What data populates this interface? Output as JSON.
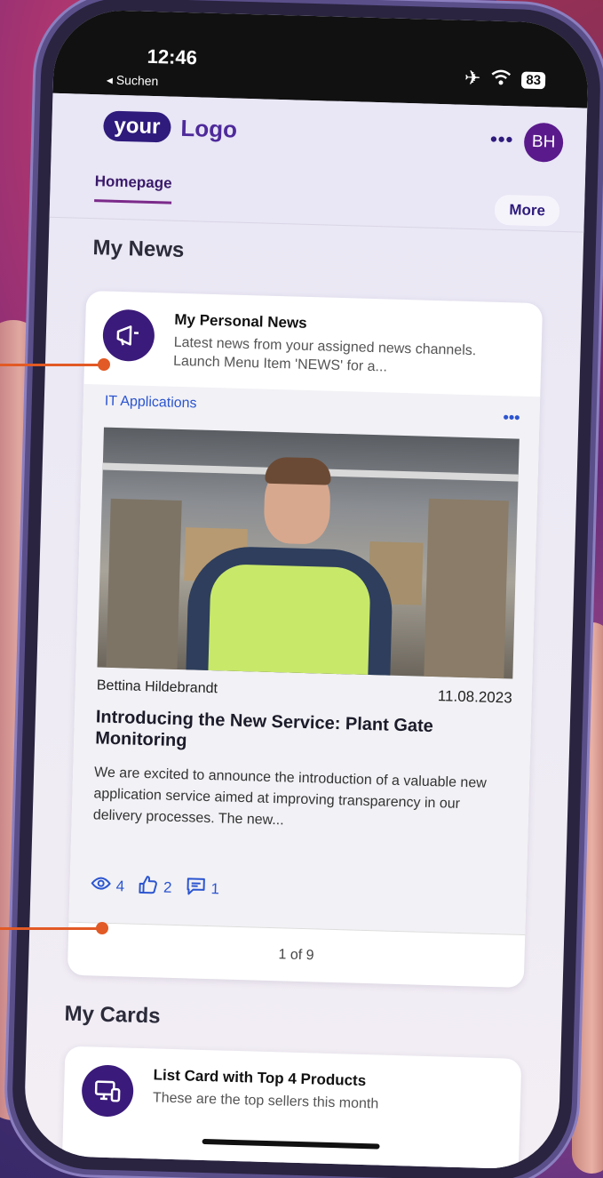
{
  "status_bar": {
    "time": "12:46",
    "back_label": "◂ Suchen",
    "battery": "83"
  },
  "header": {
    "logo_your": "your",
    "logo_text": "Logo",
    "menu_label": "•••",
    "avatar_initials": "BH"
  },
  "tabs": {
    "home": "Homepage",
    "more": "More"
  },
  "sections": {
    "news": "My News",
    "cards": "My Cards"
  },
  "news_card": {
    "title": "My Personal News",
    "subtitle": "Latest news from your assigned news channels. Launch Menu Item 'NEWS' for a...",
    "category": "IT Applications",
    "menu_label": "•••",
    "author": "Bettina Hildebrandt",
    "date": "11.08.2023",
    "headline": "Introducing the New Service: Plant Gate Monitoring",
    "text": "We are excited to announce the introduction of a valuable new application service aimed at improving transparency in our delivery processes. The new...",
    "views": "4",
    "likes": "2",
    "comments": "1",
    "pager": "1 of 9"
  },
  "list_card": {
    "title": "List Card with Top 4 Products",
    "subtitle": "These are the top sellers this month"
  },
  "colors": {
    "brand": "#2e1b7c",
    "accent_link": "#2b55d0",
    "callout": "#e25a25"
  }
}
